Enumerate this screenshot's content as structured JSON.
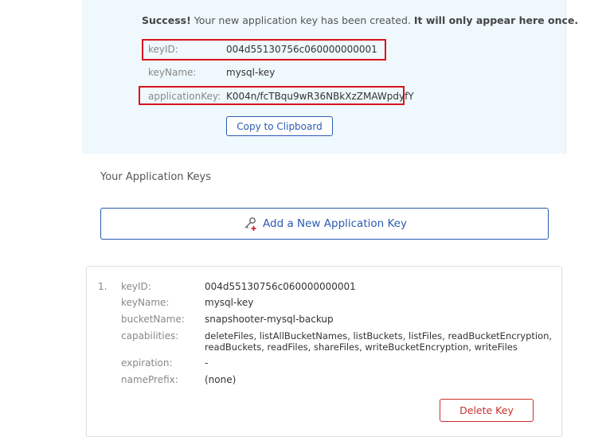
{
  "success": {
    "bold_prefix": "Success!",
    "message": " Your new application key has been created. ",
    "bold_suffix": "It will only appear here once.",
    "fields": {
      "key_id_label": "keyID:",
      "key_id_value": "004d55130756c060000000001",
      "key_name_label": "keyName:",
      "key_name_value": "mysql-key",
      "app_key_label": "applicationKey:",
      "app_key_value": "K004n/fcTBqu9wR36NBkXzZMAWpdyfY"
    },
    "copy_button": "Copy to Clipboard"
  },
  "keys_section": {
    "title": "Your Application Keys",
    "add_button": "Add a New Application Key",
    "add_icon": "key-plus-icon"
  },
  "key_card": {
    "index": "1.",
    "labels": {
      "key_id": "keyID:",
      "key_name": "keyName:",
      "bucket_name": "bucketName:",
      "capabilities": "capabilities:",
      "expiration": "expiration:",
      "name_prefix": "namePrefix:"
    },
    "values": {
      "key_id": "004d55130756c060000000001",
      "key_name": "mysql-key",
      "bucket_name": "snapshooter-mysql-backup",
      "capabilities_line1": "deleteFiles, listAllBucketNames, listBuckets, listFiles, readBucketEncryption,",
      "capabilities_line2": "readBuckets, readFiles, shareFiles, writeBucketEncryption, writeFiles",
      "expiration": "-",
      "name_prefix": "(none)"
    },
    "delete_button": "Delete Key"
  },
  "colors": {
    "accent": "#2b5bb0",
    "danger": "#c9302c",
    "highlight_box": "#d9141e",
    "panel_bg": "#eff8fc"
  }
}
